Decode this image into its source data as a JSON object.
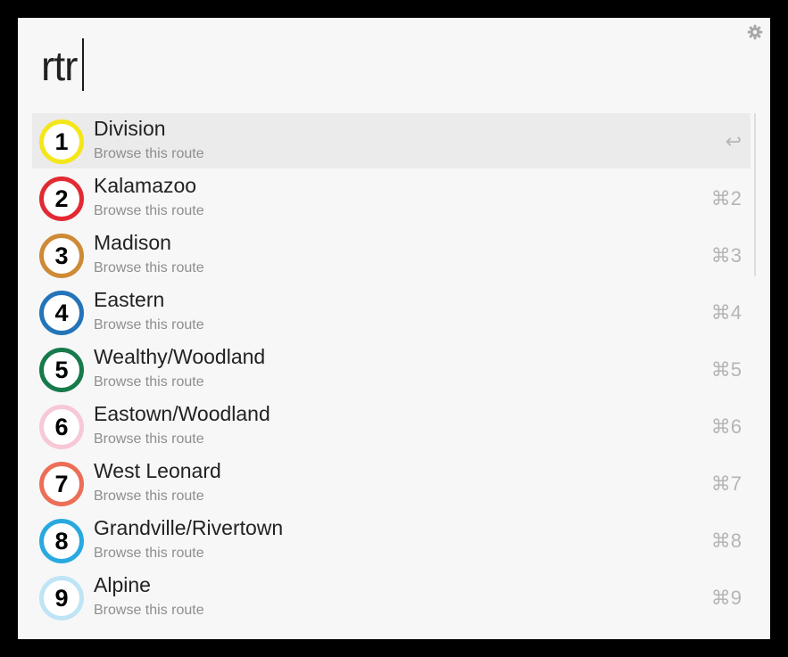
{
  "search": {
    "query": "rtr"
  },
  "settings": {
    "icon": "gear-icon"
  },
  "results": [
    {
      "number": "1",
      "title": "Division",
      "subtitle": "Browse this route",
      "shortcut": "↩",
      "color": "#f5e61a",
      "selected": true
    },
    {
      "number": "2",
      "title": "Kalamazoo",
      "subtitle": "Browse this route",
      "shortcut": "⌘2",
      "color": "#e32a33",
      "selected": false
    },
    {
      "number": "3",
      "title": "Madison",
      "subtitle": "Browse this route",
      "shortcut": "⌘3",
      "color": "#cf8a37",
      "selected": false
    },
    {
      "number": "4",
      "title": "Eastern",
      "subtitle": "Browse this route",
      "shortcut": "⌘4",
      "color": "#2374b8",
      "selected": false
    },
    {
      "number": "5",
      "title": "Wealthy/Woodland",
      "subtitle": "Browse this route",
      "shortcut": "⌘5",
      "color": "#177a4b",
      "selected": false
    },
    {
      "number": "6",
      "title": "Eastown/Woodland",
      "subtitle": "Browse this route",
      "shortcut": "⌘6",
      "color": "#f7c8d6",
      "selected": false
    },
    {
      "number": "7",
      "title": "West Leonard",
      "subtitle": "Browse this route",
      "shortcut": "⌘7",
      "color": "#ec6e57",
      "selected": false
    },
    {
      "number": "8",
      "title": "Grandville/Rivertown",
      "subtitle": "Browse this route",
      "shortcut": "⌘8",
      "color": "#28a9e0",
      "selected": false
    },
    {
      "number": "9",
      "title": "Alpine",
      "subtitle": "Browse this route",
      "shortcut": "⌘9",
      "color": "#bfe4f6",
      "selected": false
    }
  ]
}
